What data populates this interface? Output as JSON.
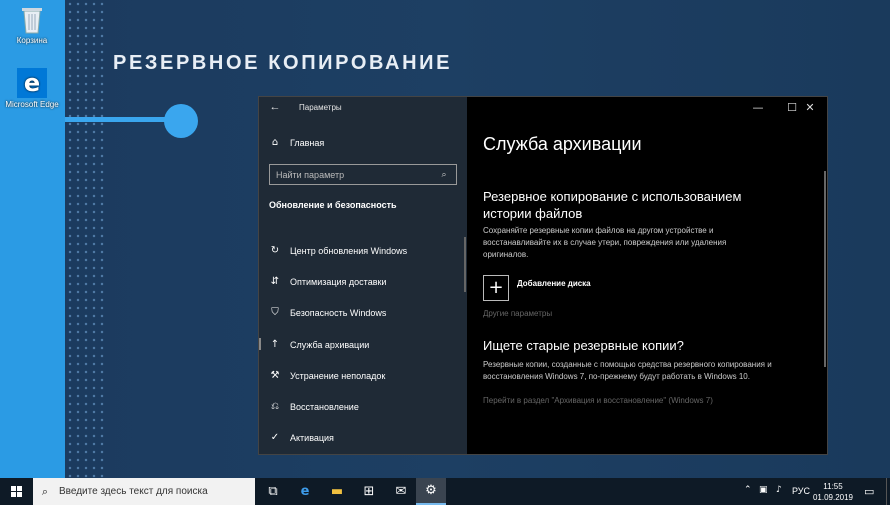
{
  "desktop": {
    "icons": [
      {
        "label": "Корзина"
      },
      {
        "label": "Microsoft Edge"
      }
    ],
    "headline": "РЕЗЕРВНОЕ КОПИРОВАНИЕ",
    "accent_color": "#3aa6ee"
  },
  "window": {
    "title": "Параметры",
    "controls": {
      "minimize": "—",
      "maximize": "☐",
      "close": "✕"
    },
    "sidebar": {
      "home_label": "Главная",
      "search_placeholder": "Найти параметр",
      "section_title": "Обновление и безопасность",
      "items": [
        {
          "label": "Центр обновления Windows",
          "icon": "refresh-icon"
        },
        {
          "label": "Оптимизация доставки",
          "icon": "delivery-icon"
        },
        {
          "label": "Безопасность Windows",
          "icon": "shield-icon"
        },
        {
          "label": "Служба архивации",
          "icon": "backup-icon",
          "active": true
        },
        {
          "label": "Устранение неполадок",
          "icon": "wrench-icon"
        },
        {
          "label": "Восстановление",
          "icon": "recovery-icon"
        },
        {
          "label": "Активация",
          "icon": "check-circle-icon"
        }
      ]
    },
    "content": {
      "title": "Служба архивации",
      "section1_title": "Резервное копирование с использованием истории файлов",
      "section1_desc": "Сохраняйте резервные копии файлов на другом устройстве и восстанавливайте их в случае утери, повреждения или удаления оригиналов.",
      "add_disk_label": "Добавление диска",
      "other_params": "Другие параметры",
      "section2_title": "Ищете старые резервные копии?",
      "section2_desc": "Резервные копии, созданные с помощью средства резервного копирования и восстановления Windows 7, по-прежнему будут работать в Windows 10.",
      "section2_link": "Перейти в раздел \"Архивация и восстановление\" (Windows 7)"
    }
  },
  "taskbar": {
    "search_placeholder": "Введите здесь текст для поиска",
    "language": "РУС",
    "time": "11:55",
    "date": "01.09.2019"
  }
}
